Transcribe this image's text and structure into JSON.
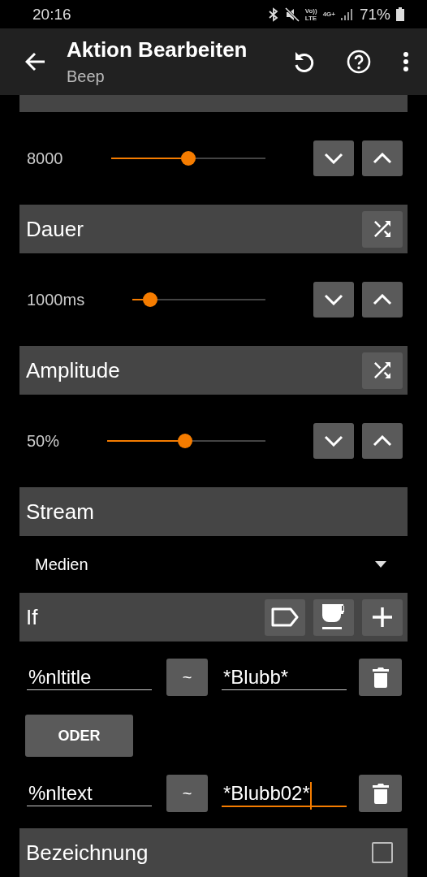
{
  "status_bar": {
    "time": "20:16",
    "volte": [
      "Vo))",
      "LTE"
    ],
    "network": "4G+",
    "battery": "71%"
  },
  "app_bar": {
    "title": "Aktion Bearbeiten",
    "subtitle": "Beep"
  },
  "sections": [
    {
      "kind": "slider",
      "value": "8000",
      "level": 0.5
    },
    {
      "kind": "slider",
      "title": "Dauer",
      "actions": [
        {
          "kind": "shuffle"
        }
      ],
      "value": "1000ms",
      "level": 0.09
    },
    {
      "kind": "slider",
      "title": "Amplitude",
      "actions": [
        {
          "kind": "shuffle"
        }
      ],
      "value": "50%",
      "level": 0.49
    },
    {
      "kind": "dropdown",
      "title": "Stream",
      "value": "Medien"
    },
    {
      "kind": "conditions",
      "title": "If",
      "actions": [
        {
          "kind": "tag"
        },
        {
          "kind": "cup"
        },
        {
          "kind": "plus"
        }
      ],
      "items": [
        {
          "kind": "condition",
          "left": "%nltitle",
          "operator": "~",
          "right": "*Blubb*",
          "focused": false
        },
        {
          "kind": "join",
          "label": "ODER"
        },
        {
          "kind": "condition",
          "left": "%nltext",
          "operator": "~",
          "right": "*Blubb02*",
          "focused": true
        }
      ]
    },
    {
      "kind": "checkbox",
      "title": "Bezeichnung",
      "checked": false
    }
  ]
}
